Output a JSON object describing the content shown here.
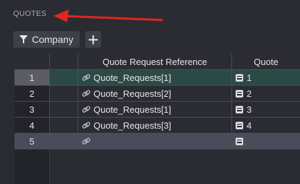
{
  "section": {
    "title": "QUOTES"
  },
  "toolbar": {
    "company_label": "Company",
    "add_symbol": "+"
  },
  "table": {
    "columns": [
      "Quote Request Reference",
      "Quote"
    ],
    "rows": [
      {
        "num": "1",
        "reference": "Quote_Requests[1]",
        "quote": "1",
        "selected": true
      },
      {
        "num": "2",
        "reference": "Quote_Requests[2]",
        "quote": "2"
      },
      {
        "num": "3",
        "reference": "Quote_Requests[1]",
        "quote": "3"
      },
      {
        "num": "4",
        "reference": "Quote_Requests[3]",
        "quote": "4"
      },
      {
        "num": "5",
        "reference": "",
        "quote": "",
        "new_row": true
      }
    ]
  },
  "colors": {
    "selected_row": "#2c4a45",
    "new_row": "#4a4c5a",
    "accent_green": "#2f8f5b",
    "annotation_red": "#e0271f"
  },
  "icons": {
    "filter": "filter-icon",
    "plus": "plus-icon",
    "link": "link-icon",
    "reference_field": "equals-icon"
  }
}
